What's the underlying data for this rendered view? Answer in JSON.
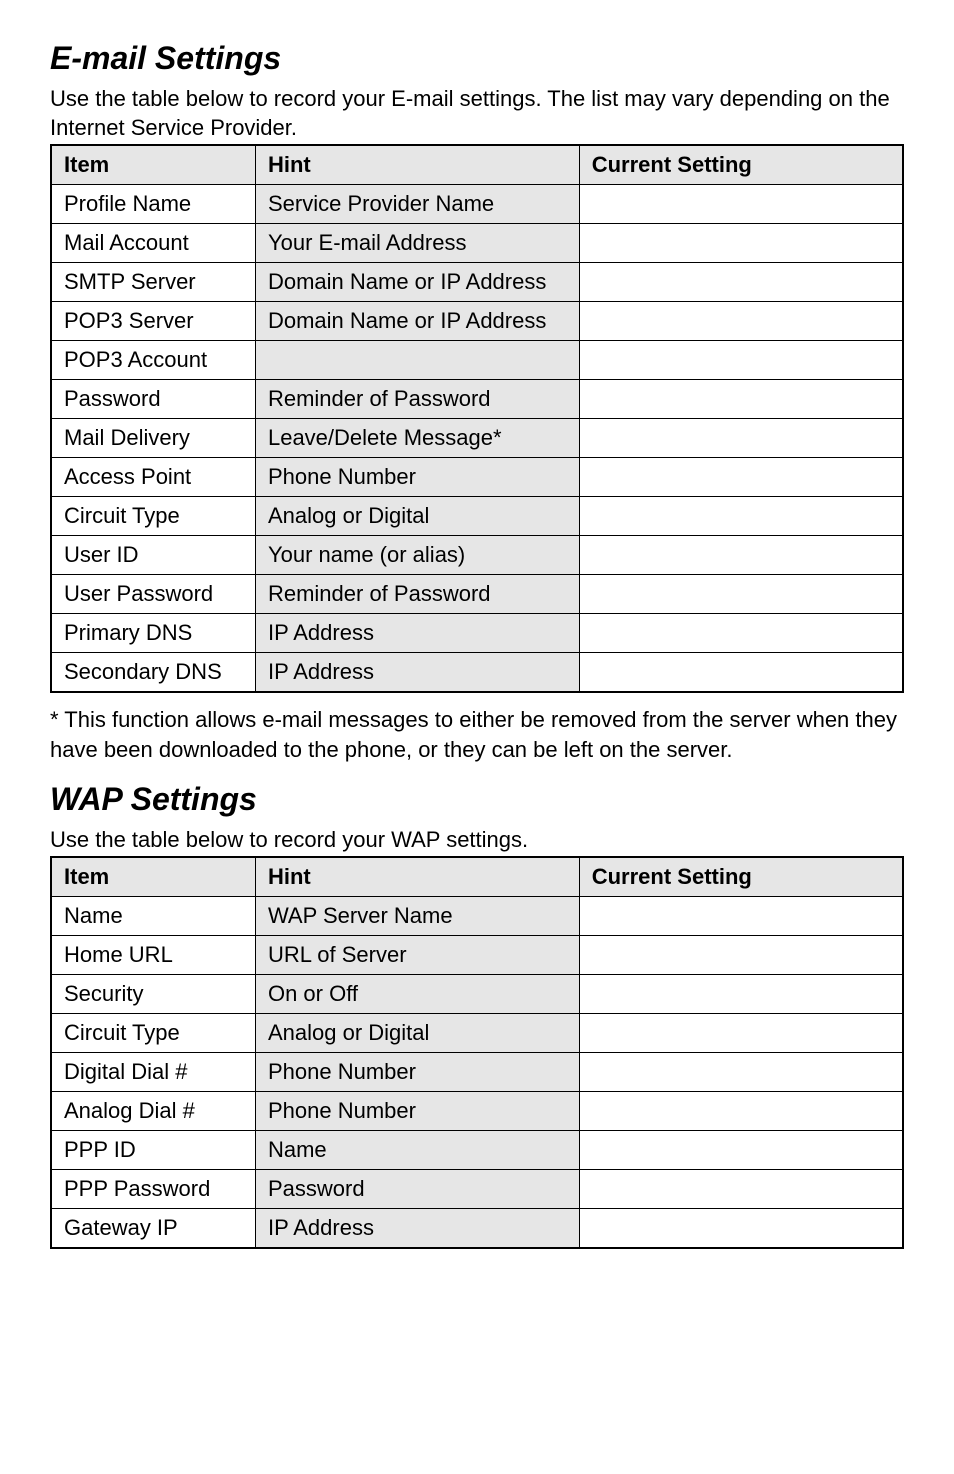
{
  "email": {
    "heading": "E-mail Settings",
    "intro": "Use the table below to record your E-mail settings. The list may vary depending on the Internet Service Provider.",
    "headers": {
      "item": "Item",
      "hint": "Hint",
      "setting": "Current Setting"
    },
    "rows": [
      {
        "item": "Profile Name",
        "hint": "Service Provider Name",
        "setting": ""
      },
      {
        "item": "Mail Account",
        "hint": "Your E-mail Address",
        "setting": ""
      },
      {
        "item": "SMTP Server",
        "hint": "Domain Name or IP Address",
        "setting": ""
      },
      {
        "item": "POP3 Server",
        "hint": "Domain Name or IP Address",
        "setting": ""
      },
      {
        "item": "POP3 Account",
        "hint": "",
        "setting": ""
      },
      {
        "item": "Password",
        "hint": "Reminder of Password",
        "setting": ""
      },
      {
        "item": "Mail Delivery",
        "hint": "Leave/Delete Message*",
        "setting": ""
      },
      {
        "item": "Access Point",
        "hint": "Phone Number",
        "setting": ""
      },
      {
        "item": "Circuit Type",
        "hint": "Analog or Digital",
        "setting": ""
      },
      {
        "item": "User ID",
        "hint": "Your name (or alias)",
        "setting": ""
      },
      {
        "item": "User Password",
        "hint": "Reminder of Password",
        "setting": ""
      },
      {
        "item": "Primary DNS",
        "hint": "IP Address",
        "setting": ""
      },
      {
        "item": "Secondary DNS",
        "hint": "IP Address",
        "setting": ""
      }
    ],
    "footnote": "* This function allows e-mail messages to either be removed from the server when they have been downloaded to the phone, or they can be left on the server."
  },
  "wap": {
    "heading": "WAP Settings",
    "intro": "Use the table below to record your WAP settings.",
    "headers": {
      "item": "Item",
      "hint": "Hint",
      "setting": "Current Setting"
    },
    "rows": [
      {
        "item": "Name",
        "hint": "WAP Server Name",
        "setting": ""
      },
      {
        "item": "Home URL",
        "hint": "URL of Server",
        "setting": ""
      },
      {
        "item": "Security",
        "hint": "On or Off",
        "setting": ""
      },
      {
        "item": "Circuit Type",
        "hint": "Analog or Digital",
        "setting": ""
      },
      {
        "item": "Digital Dial #",
        "hint": "Phone Number",
        "setting": ""
      },
      {
        "item": "Analog Dial #",
        "hint": "Phone Number",
        "setting": ""
      },
      {
        "item": "PPP ID",
        "hint": "Name",
        "setting": ""
      },
      {
        "item": "PPP Password",
        "hint": "Password",
        "setting": ""
      },
      {
        "item": "Gateway IP",
        "hint": "IP Address",
        "setting": ""
      }
    ]
  }
}
